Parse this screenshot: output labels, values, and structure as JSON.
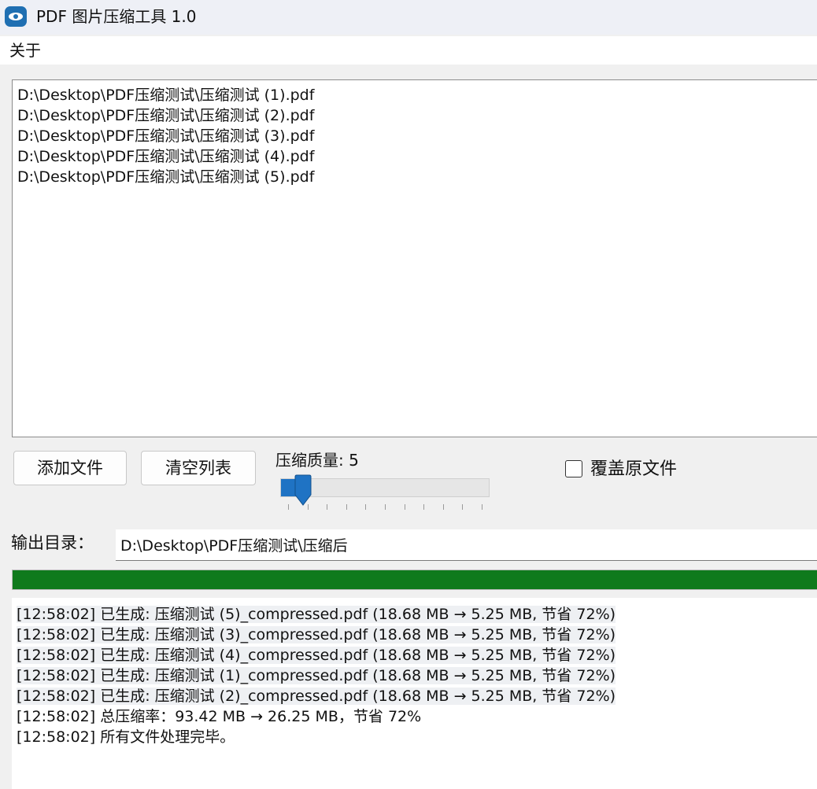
{
  "window": {
    "title": "PDF 图片压缩工具 1.0",
    "icon": "app-logo-icon"
  },
  "menu": {
    "items": [
      {
        "label": "关于"
      }
    ]
  },
  "file_list": {
    "items": [
      "D:\\Desktop\\PDF压缩测试\\压缩测试 (1).pdf",
      "D:\\Desktop\\PDF压缩测试\\压缩测试 (2).pdf",
      "D:\\Desktop\\PDF压缩测试\\压缩测试 (3).pdf",
      "D:\\Desktop\\PDF压缩测试\\压缩测试 (4).pdf",
      "D:\\Desktop\\PDF压缩测试\\压缩测试 (5).pdf"
    ]
  },
  "controls": {
    "add_label": "添加文件",
    "clear_label": "清空列表",
    "quality_label": "压缩质量: 5",
    "quality_value": 5,
    "quality_min": 1,
    "quality_max": 100,
    "overwrite_label": "覆盖原文件",
    "overwrite_checked": false
  },
  "output": {
    "label": "输出目录：",
    "value": "D:\\Desktop\\PDF压缩测试\\压缩后"
  },
  "progress": {
    "percent": 100,
    "color": "#0f7a1c"
  },
  "log": {
    "lines": [
      "[12:58:02] 已生成: 压缩测试 (5)_compressed.pdf  (18.68 MB → 5.25 MB, 节省 72%)",
      "[12:58:02] 已生成: 压缩测试 (3)_compressed.pdf  (18.68 MB → 5.25 MB, 节省 72%)",
      "[12:58:02] 已生成: 压缩测试 (4)_compressed.pdf  (18.68 MB → 5.25 MB, 节省 72%)",
      "[12:58:02] 已生成: 压缩测试 (1)_compressed.pdf  (18.68 MB → 5.25 MB, 节省 72%)",
      "[12:58:02] 已生成: 压缩测试 (2)_compressed.pdf  (18.68 MB → 5.25 MB, 节省 72%)",
      "[12:58:02] 总压缩率：93.42 MB → 26.25 MB，节省 72%",
      "[12:58:02] 所有文件处理完毕。"
    ],
    "highlighted_count": 5
  },
  "colors": {
    "accent": "#1f73c4",
    "success": "#0f7a1c"
  }
}
